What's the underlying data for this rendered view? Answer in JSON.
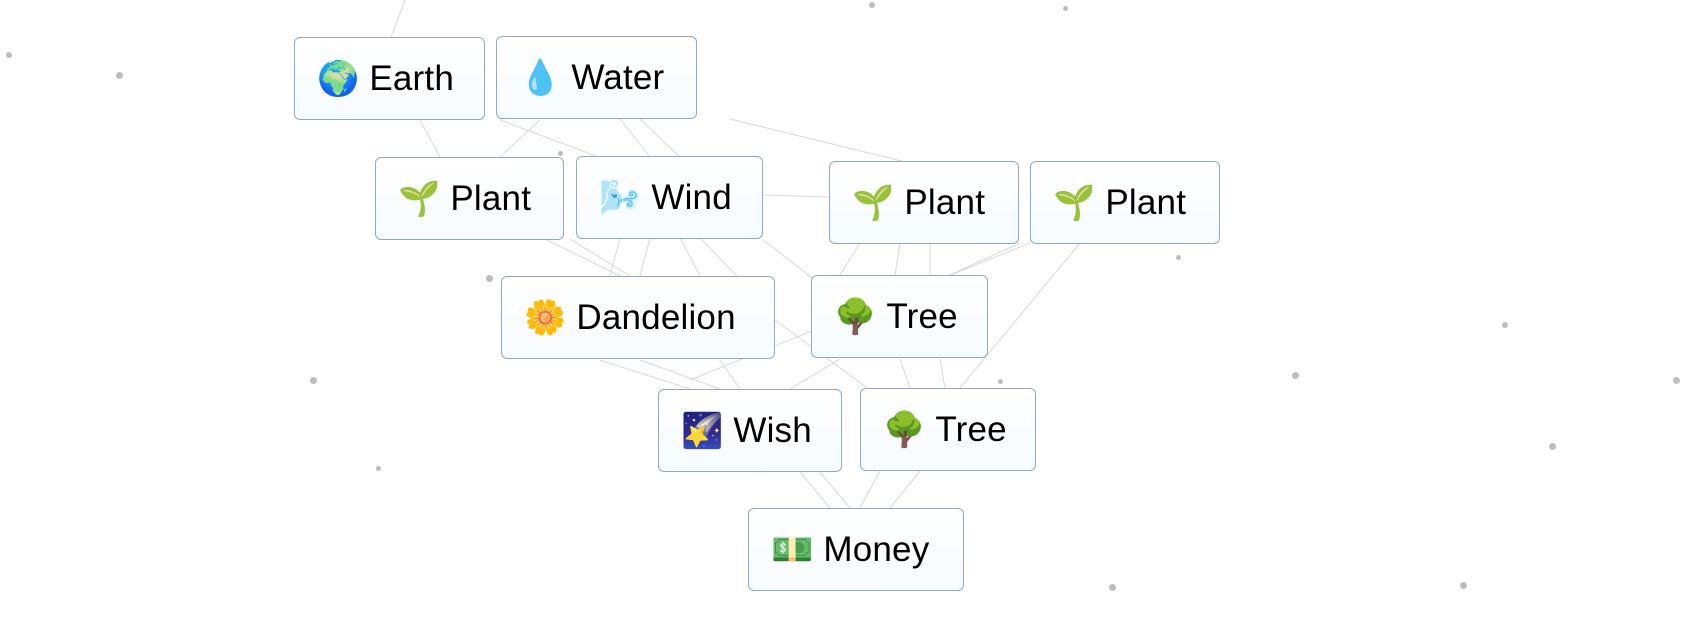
{
  "items": [
    {
      "label": "Earth",
      "icon": "🌍",
      "icon_name": "globe-africa-icon"
    },
    {
      "label": "Water",
      "icon": "💧",
      "icon_name": "droplet-icon"
    },
    {
      "label": "Plant",
      "icon": "🌱",
      "icon_name": "seedling-icon"
    },
    {
      "label": "Wind",
      "icon": "🌬️",
      "icon_name": "wind-face-icon"
    },
    {
      "label": "Plant",
      "icon": "🌱",
      "icon_name": "seedling-icon"
    },
    {
      "label": "Plant",
      "icon": "🌱",
      "icon_name": "seedling-icon"
    },
    {
      "label": "Dandelion",
      "icon": "🌼",
      "icon_name": "blossom-icon"
    },
    {
      "label": "Tree",
      "icon": "🌳",
      "icon_name": "tree-icon"
    },
    {
      "label": "Wish",
      "icon": "🌠",
      "icon_name": "shooting-star-icon"
    },
    {
      "label": "Tree",
      "icon": "🌳",
      "icon_name": "tree-icon"
    },
    {
      "label": "Money",
      "icon": "💵",
      "icon_name": "dollar-banknote-icon"
    }
  ],
  "colors": {
    "item_border": "#93a9c2",
    "line": "#d8d8d8",
    "dot": "#bdbdbd"
  }
}
